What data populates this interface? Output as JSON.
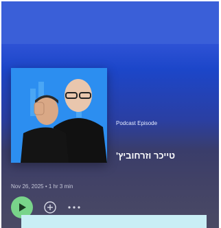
{
  "episode": {
    "type_label": "Podcast Episode",
    "title": "טייכר וזרחוביץ'",
    "meta": "Nov 26, 2025 • 1 hr 3 min"
  },
  "cover": {
    "image_name": "podcast-cover-art"
  },
  "controls": {
    "play_icon": "play-icon",
    "add_icon": "add-circle-icon",
    "more_icon": "more-horizontal-icon"
  },
  "colors": {
    "top_bar": "#3a5fd8",
    "cover_bg": "#2c8ef0",
    "play_button": "#79d48a",
    "overlay_panel": "#c9eef5"
  }
}
